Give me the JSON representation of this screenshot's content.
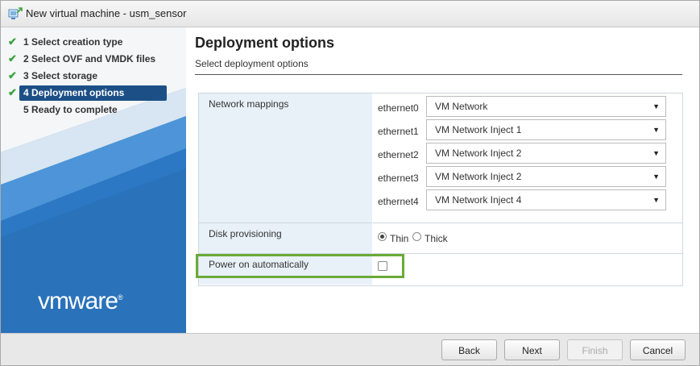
{
  "window": {
    "title": "New virtual machine - usm_sensor"
  },
  "sidebar": {
    "steps": [
      {
        "label": "1  Select creation type",
        "done": true
      },
      {
        "label": "2  Select OVF and VMDK files",
        "done": true
      },
      {
        "label": "3  Select storage",
        "done": true
      },
      {
        "label": "4  Deployment options",
        "done": true,
        "active": true
      },
      {
        "label": "5  Ready to complete",
        "done": false
      }
    ],
    "logo": {
      "light": "vm",
      "rest": "ware",
      "mark": "®"
    }
  },
  "main": {
    "title": "Deployment options",
    "subtitle": "Select deployment options",
    "network_mappings": {
      "label": "Network mappings",
      "rows": [
        {
          "adapter": "ethernet0",
          "network": "VM Network"
        },
        {
          "adapter": "ethernet1",
          "network": "VM Network Inject 1"
        },
        {
          "adapter": "ethernet2",
          "network": "VM Network Inject 2"
        },
        {
          "adapter": "ethernet3",
          "network": "VM Network Inject 2"
        },
        {
          "adapter": "ethernet4",
          "network": "VM Network Inject 4"
        }
      ]
    },
    "disk_provisioning": {
      "label": "Disk provisioning",
      "options": [
        "Thin",
        "Thick"
      ],
      "selected": "Thin"
    },
    "power_on": {
      "label": "Power on automatically",
      "checked": false
    }
  },
  "footer": {
    "back": "Back",
    "next": "Next",
    "finish": "Finish",
    "cancel": "Cancel"
  },
  "colors": {
    "sidebar_bg": "#2c78c4",
    "active_step": "#1c4f86",
    "check": "#3ca33c",
    "highlight": "#6aaa38"
  },
  "icons": {
    "title": "virtual-machine-icon",
    "step_done": "checkmark-icon",
    "dropdown": "triangle-down-icon"
  }
}
